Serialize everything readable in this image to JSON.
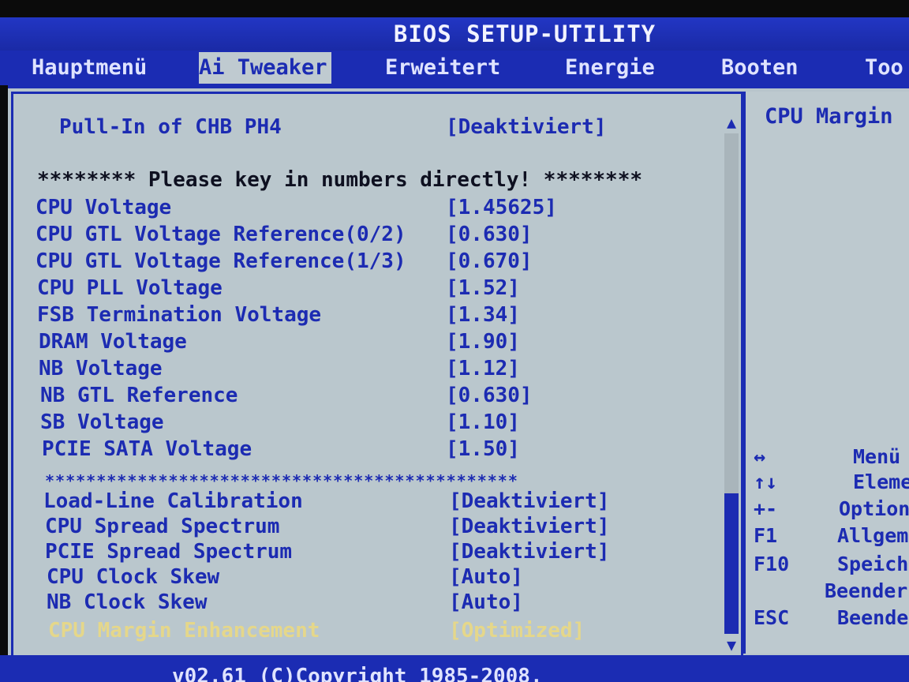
{
  "title": "BIOS SETUP-UTILITY",
  "menu": [
    {
      "label": "Hauptmenü"
    },
    {
      "label": "Ai Tweaker",
      "active": true
    },
    {
      "label": "Erweitert"
    },
    {
      "label": "Energie"
    },
    {
      "label": "Booten"
    },
    {
      "label": "Too"
    }
  ],
  "settings": {
    "pull_in": {
      "label": "Pull-In of CHB PH4",
      "value": "[Deaktiviert]"
    },
    "key_in_note": "******** Please key in numbers directly! ********",
    "voltages": [
      {
        "label": "CPU Voltage",
        "value": "[1.45625]"
      },
      {
        "label": "CPU GTL Voltage Reference(0/2)",
        "value": "[0.630]"
      },
      {
        "label": "CPU GTL Voltage Reference(1/3)",
        "value": "[0.670]"
      },
      {
        "label": "CPU PLL Voltage",
        "value": "[1.52]"
      },
      {
        "label": "FSB Termination Voltage",
        "value": "[1.34]"
      },
      {
        "label": "DRAM Voltage",
        "value": "[1.90]"
      },
      {
        "label": "NB Voltage",
        "value": "[1.12]"
      },
      {
        "label": "NB GTL Reference",
        "value": "[0.630]"
      },
      {
        "label": "SB Voltage",
        "value": "[1.10]"
      },
      {
        "label": "PCIE SATA Voltage",
        "value": "[1.50]"
      }
    ],
    "separator": "**********************************************",
    "other": [
      {
        "label": "Load-Line Calibration",
        "value": "[Deaktiviert]"
      },
      {
        "label": "CPU Spread Spectrum",
        "value": "[Deaktiviert]"
      },
      {
        "label": "PCIE Spread Spectrum",
        "value": "[Deaktiviert]"
      },
      {
        "label": "CPU Clock Skew",
        "value": "[Auto]"
      },
      {
        "label": "NB Clock Skew",
        "value": "[Auto]"
      },
      {
        "label": "CPU Margin Enhancement",
        "value": "[Optimized]"
      }
    ]
  },
  "scrollbar": {
    "up_icon": "▲",
    "down_icon": "▼",
    "thumb_start": 0.72,
    "thumb_end": 1.0
  },
  "help": {
    "title": "CPU Margin",
    "keys": [
      {
        "key": "↔",
        "desc": "Menü"
      },
      {
        "key": "↑↓",
        "desc": "Eleme"
      },
      {
        "key": "+-",
        "desc": "Option"
      },
      {
        "key": "F1",
        "desc": "Allgem"
      },
      {
        "key": "F10",
        "desc": "Speich"
      },
      {
        "key": "",
        "desc": "Beender"
      },
      {
        "key": "ESC",
        "desc": "Beende"
      }
    ]
  },
  "footer": "v02.61 (C)Copyright 1985-2008,"
}
